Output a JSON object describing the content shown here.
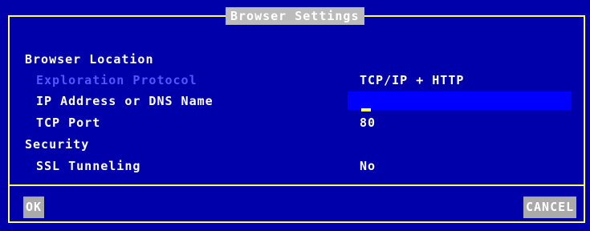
{
  "dialog": {
    "title": "Browser Settings"
  },
  "sections": {
    "location": "Browser Location",
    "security": "Security"
  },
  "fields": {
    "protocol": {
      "label": "Exploration Protocol",
      "value": "TCP/IP + HTTP"
    },
    "ip": {
      "label": "IP Address or DNS Name",
      "value": ""
    },
    "port": {
      "label": "TCP Port",
      "value": "80"
    },
    "ssl": {
      "label": "SSL Tunneling",
      "value": "No"
    }
  },
  "buttons": {
    "ok": "OK",
    "cancel": "CANCEL"
  },
  "colors": {
    "background": "#0000aa",
    "border": "#ffff55",
    "field": "#0000ff",
    "disabled": "#5555ff"
  }
}
